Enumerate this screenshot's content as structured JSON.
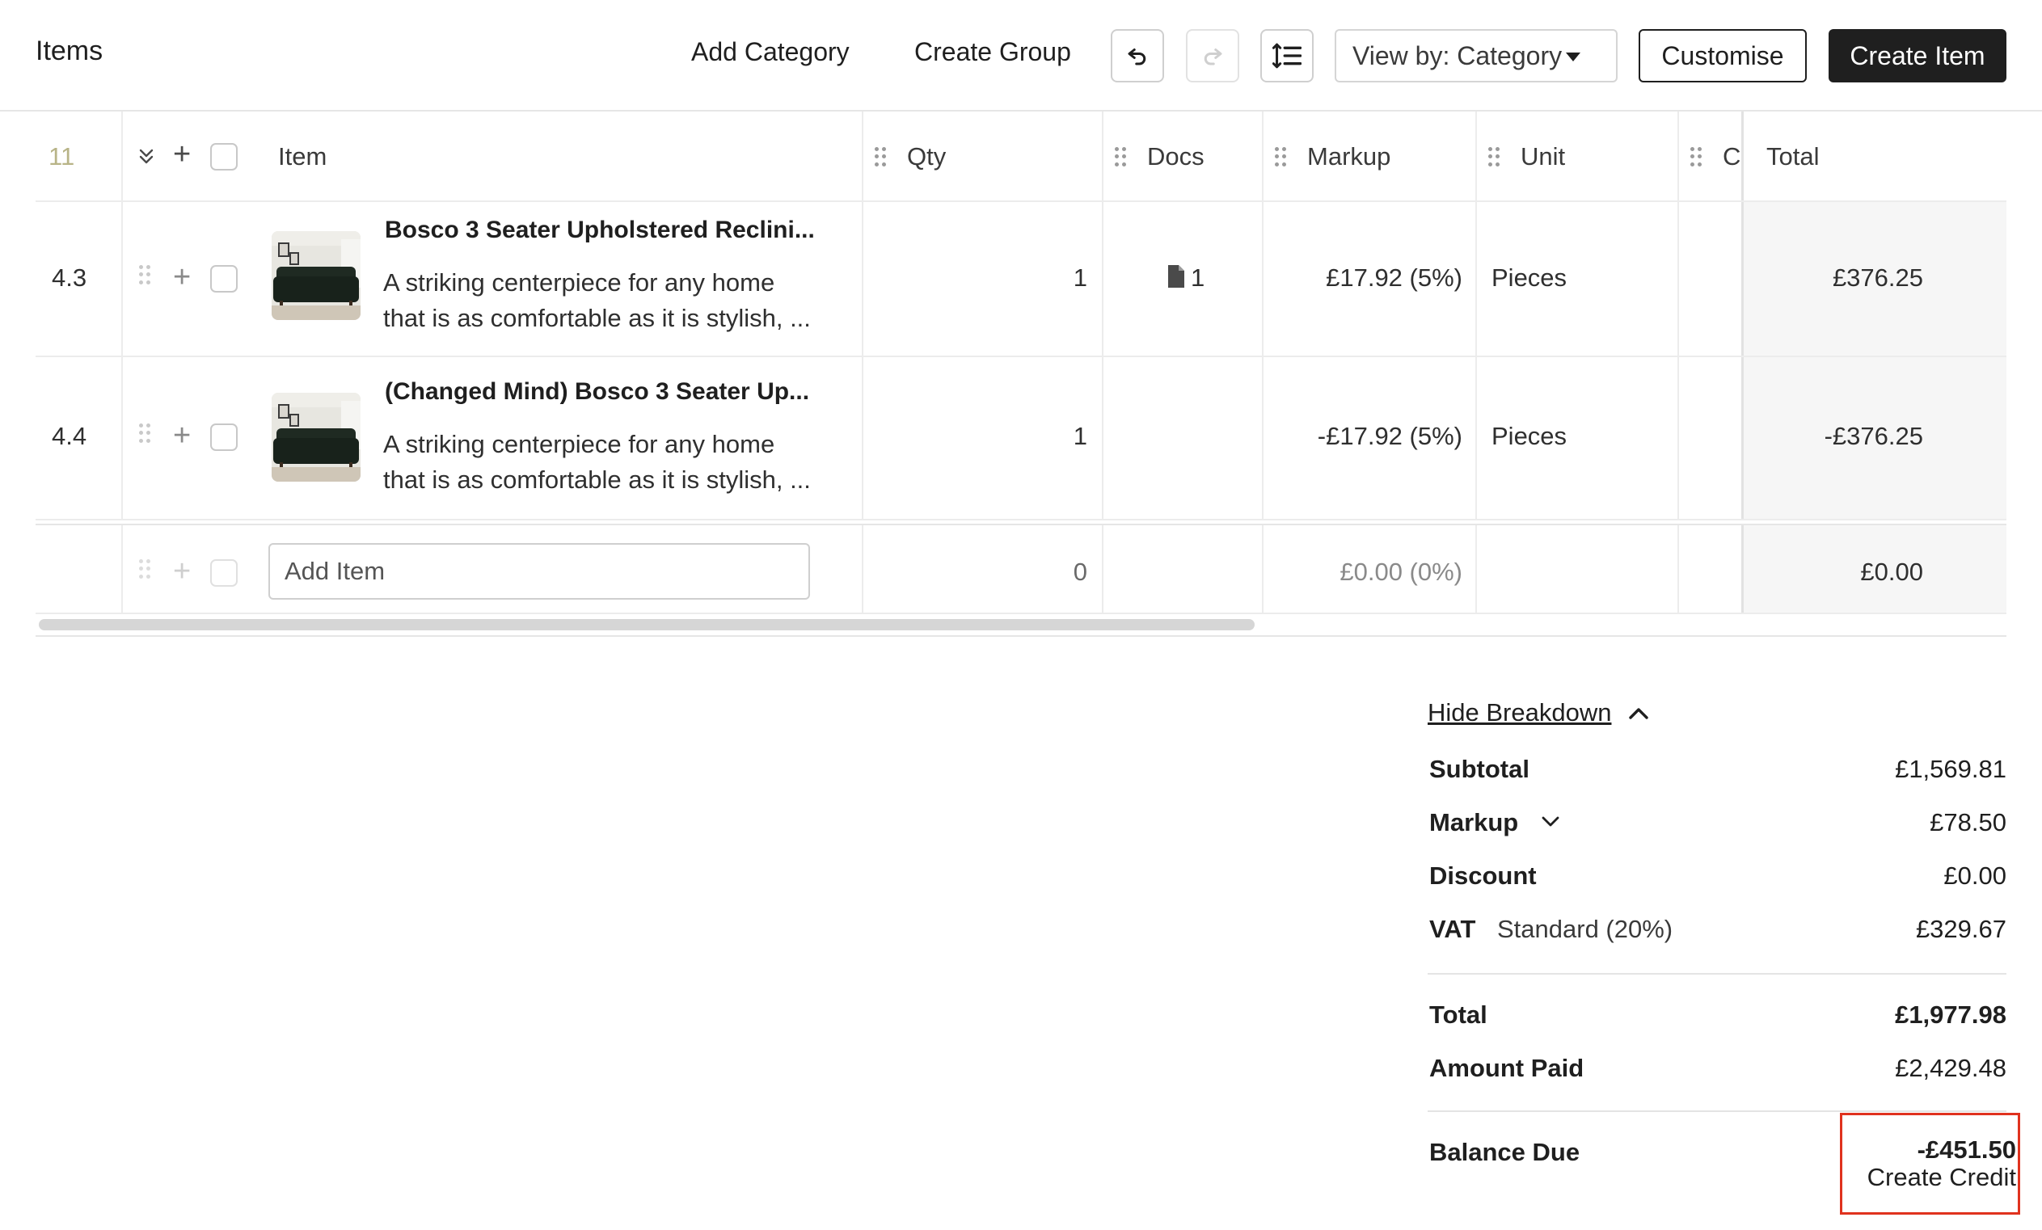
{
  "header": {
    "title": "Items",
    "add_category": "Add Category",
    "create_group": "Create Group",
    "view_by": "View by: Category",
    "customise": "Customise",
    "create_item": "Create Item"
  },
  "table": {
    "header": {
      "row_number": "11",
      "item": "Item",
      "qty": "Qty",
      "docs": "Docs",
      "markup": "Markup",
      "unit": "Unit",
      "cost": "Cost",
      "total": "Total"
    },
    "rows": [
      {
        "number": "4.3",
        "title": "Bosco 3 Seater Upholstered Reclini...",
        "description": "A striking centerpiece for any home that is as comfortable as it is stylish, ...",
        "qty": "1",
        "docs": "1",
        "markup": "£17.92 (5%)",
        "unit": "Pieces",
        "cost": "£",
        "total": "£376.25"
      },
      {
        "number": "4.4",
        "title": "(Changed Mind) Bosco 3 Seater Up...",
        "description": "A striking centerpiece for any home that is as comfortable as it is stylish, ...",
        "qty": "1",
        "docs": "",
        "markup": "-£17.92 (5%)",
        "unit": "Pieces",
        "cost": "-£",
        "total": "-£376.25"
      }
    ],
    "add_row": {
      "placeholder": "Add Item",
      "qty": "0",
      "markup": "£0.00 (0%)",
      "total": "£0.00"
    }
  },
  "summary": {
    "toggle": "Hide Breakdown",
    "subtotal_label": "Subtotal",
    "subtotal_value": "£1,569.81",
    "markup_label": "Markup",
    "markup_value": "£78.50",
    "discount_label": "Discount",
    "discount_value": "£0.00",
    "vat_label": "VAT",
    "vat_rate": "Standard (20%)",
    "vat_value": "£329.67",
    "total_label": "Total",
    "total_value": "£1,977.98",
    "paid_label": "Amount Paid",
    "paid_value": "£2,429.48",
    "balance_label": "Balance Due",
    "balance_value": "-£451.50",
    "create_credit": "Create Credit"
  },
  "colors": {
    "primary_dark": "#1f1f1f",
    "highlight_border": "#e0321e",
    "row_number_muted": "#b8b487"
  }
}
